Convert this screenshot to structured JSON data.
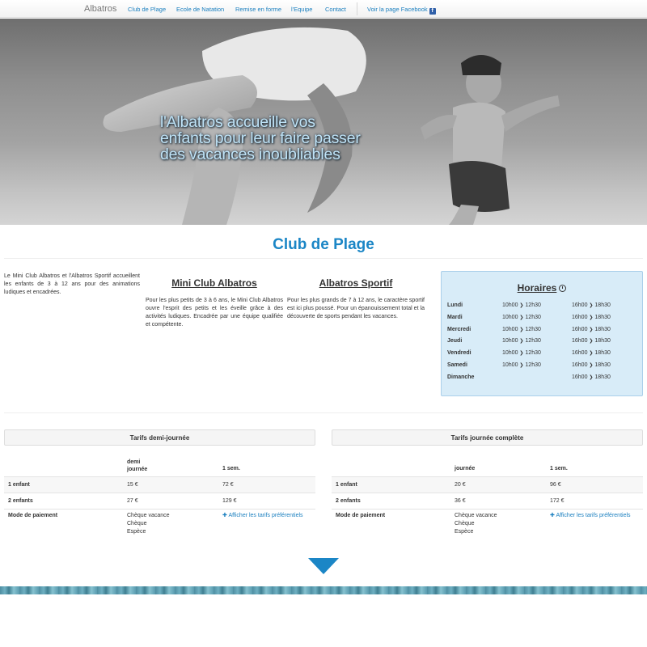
{
  "nav": {
    "brand": "Albatros",
    "links": [
      "Club de Plage",
      "Ecole de Natation",
      "Remise en forme",
      "l'Equipe",
      "Contact"
    ],
    "facebook": "Voir la page Facebook",
    "facebook_icon": "f"
  },
  "hero": {
    "line1": "l'Albatros accueille vos",
    "line2": "enfants pour leur faire passer",
    "line3": "des vacances inoubliables"
  },
  "section_title": "Club de Plage",
  "intro": "Le Mini Club Albatros et l'Albatros Sportif accueillent les enfants de 3 à 12 ans pour des animations ludiques et encadrées.",
  "mini_club": {
    "title": "Mini Club Albatros",
    "text": "Pour les plus petits de 3 à 6 ans, le Mini Club Albatros ouvre l'esprit des petits et les éveille grâce à des activités ludiques. Encadrée par une équipe qualifiée et compétente."
  },
  "sportif": {
    "title": "Albatros Sportif",
    "text": "Pour les plus grands de 7 à 12 ans, le caractère sportif est ici plus poussé. Pour un épanouissement total et la découverte de sports pendant les vacances."
  },
  "horaires": {
    "title": "Horaires",
    "rows": [
      {
        "day": "Lundi",
        "m_start": "10h00",
        "m_end": "12h30",
        "a_start": "16h00",
        "a_end": "18h30"
      },
      {
        "day": "Mardi",
        "m_start": "10h00",
        "m_end": "12h30",
        "a_start": "16h00",
        "a_end": "18h30"
      },
      {
        "day": "Mercredi",
        "m_start": "10h00",
        "m_end": "12h30",
        "a_start": "16h00",
        "a_end": "18h30"
      },
      {
        "day": "Jeudi",
        "m_start": "10h00",
        "m_end": "12h30",
        "a_start": "16h00",
        "a_end": "18h30"
      },
      {
        "day": "Vendredi",
        "m_start": "10h00",
        "m_end": "12h30",
        "a_start": "16h00",
        "a_end": "18h30"
      },
      {
        "day": "Samedi",
        "m_start": "10h00",
        "m_end": "12h30",
        "a_start": "16h00",
        "a_end": "18h30"
      },
      {
        "day": "Dimanche",
        "m_start": "",
        "m_end": "",
        "a_start": "16h00",
        "a_end": "18h30"
      }
    ]
  },
  "tarif_demi": {
    "title": "Tarifs demi-journée",
    "col1_line1": "demi",
    "col1_line2": "journée",
    "col2": "1 sem.",
    "row1": {
      "label": "1 enfant",
      "v1": "15 €",
      "v2": "72 €"
    },
    "row2": {
      "label": "2 enfants",
      "v1": "27 €",
      "v2": "129 €"
    },
    "payment_label": "Mode de paiement",
    "payment_methods": [
      "Chèque vacance",
      "Chèque",
      "Espèce"
    ],
    "link": "Afficher les tarifs préférentiels"
  },
  "tarif_complete": {
    "title": "Tarifs journée complète",
    "col1": "journée",
    "col2": "1 sem.",
    "row1": {
      "label": "1 enfant",
      "v1": "20 €",
      "v2": "96 €"
    },
    "row2": {
      "label": "2 enfants",
      "v1": "36 €",
      "v2": "172 €"
    },
    "payment_label": "Mode de paiement",
    "payment_methods": [
      "Chèque vacance",
      "Chèque",
      "Espèce"
    ],
    "link": "Afficher les tarifs préférentiels"
  },
  "colors": {
    "accent": "#1b86c6",
    "link": "#1a7fbf",
    "horaires_bg": "#d8ecf8"
  }
}
